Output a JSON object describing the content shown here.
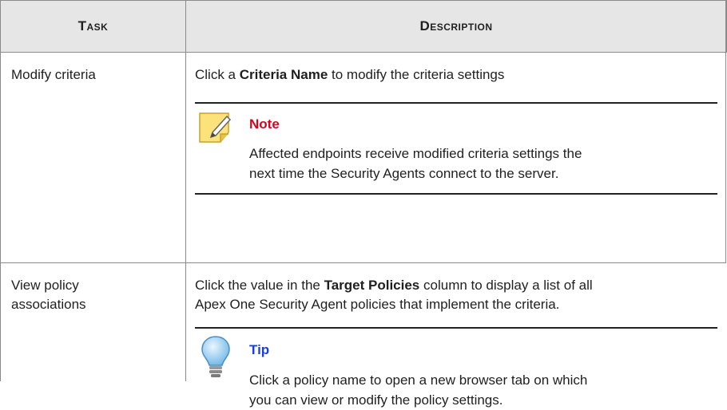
{
  "header": {
    "task": "Task",
    "description": "Description"
  },
  "rows": [
    {
      "task": "Modify criteria",
      "desc_pre": "Click a ",
      "desc_bold": "Criteria Name",
      "desc_post": " to modify the criteria settings",
      "admonition": {
        "icon": "note-icon",
        "title": "Note",
        "title_color": "#e0001b",
        "line1": "Affected endpoints receive modified criteria settings the",
        "line2": "next time the Security Agents connect to the server."
      }
    },
    {
      "task_line1": "View policy",
      "task_line2": "associations",
      "desc_pre": "Click the value in the ",
      "desc_bold": "Target Policies",
      "desc_post": " column to display a list of all",
      "desc_line2": "Apex One Security Agent policies that implement the criteria.",
      "admonition": {
        "icon": "lightbulb-tip-icon",
        "title": "Tip",
        "title_color": "#1a3fe0",
        "line1": "Click a policy name to open a new browser tab on which",
        "line2": "you can view or modify the policy settings."
      }
    }
  ]
}
